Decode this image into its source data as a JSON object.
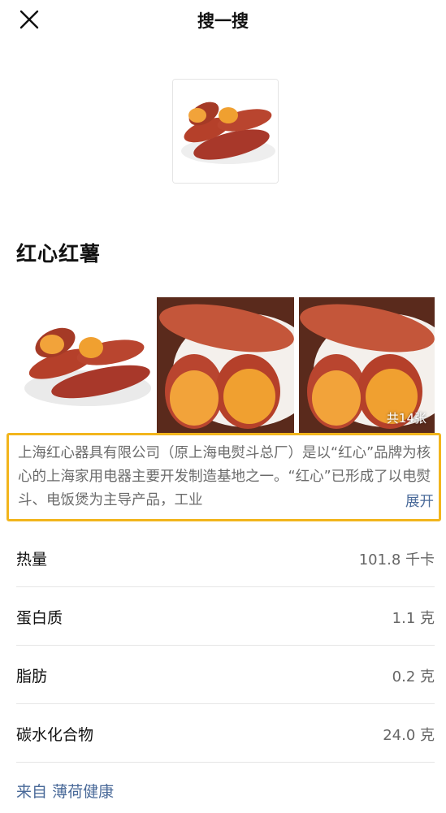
{
  "header": {
    "title": "搜一搜"
  },
  "entity": {
    "title": "红心红薯"
  },
  "gallery": {
    "count_label": "共14张"
  },
  "description": {
    "text": "上海红心器具有限公司（原上海电熨斗总厂）是以“红心”品牌为核心的上海家用电器主要开发制造基地之一。“红心”已形成了以电熨斗、电饭煲为主导产品，工业",
    "expand_label": "展开"
  },
  "nutrition": [
    {
      "name": "热量",
      "value": "101.8 千卡"
    },
    {
      "name": "蛋白质",
      "value": "1.1 克"
    },
    {
      "name": "脂肪",
      "value": "0.2 克"
    },
    {
      "name": "碳水化合物",
      "value": "24.0 克"
    }
  ],
  "source": {
    "prefix": "来自",
    "name": "薄荷健康"
  },
  "colors": {
    "highlight_border": "#f2b51c",
    "link": "#4a6a99",
    "sweet_potato_skin": "#b5402a",
    "sweet_potato_flesh": "#f2a33a"
  }
}
